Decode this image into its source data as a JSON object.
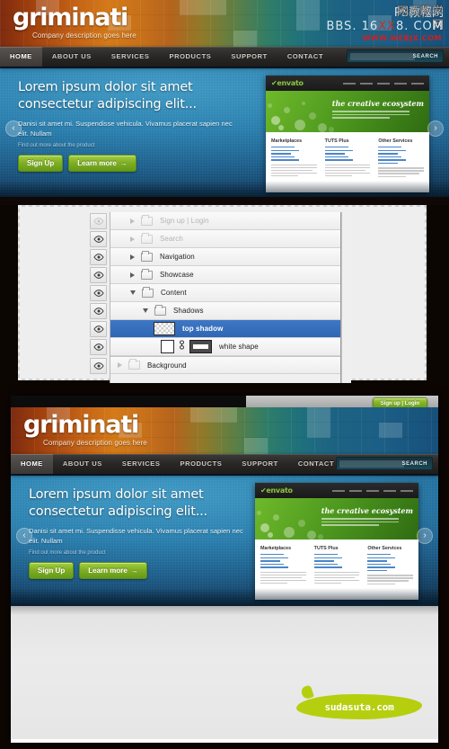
{
  "brand": {
    "logo": "griminati",
    "tagline": "Company description goes here",
    "accent_orange": "#d47a19",
    "accent_blue": "#2a7fae",
    "accent_green": "#7fae24"
  },
  "watermark": {
    "line1": "PS教程网",
    "line1_overlay": "网页教学网",
    "line2_pre": "BBS. 16",
    "line2_red": "XX",
    "line2_post": "8. COM",
    "line2_overlay": "WWW.WEBJX.COM"
  },
  "nav": {
    "items": [
      {
        "label": "HOME",
        "active": true
      },
      {
        "label": "ABOUT US",
        "active": false
      },
      {
        "label": "SERVICES",
        "active": false
      },
      {
        "label": "PRODUCTS",
        "active": false
      },
      {
        "label": "SUPPORT",
        "active": false
      },
      {
        "label": "CONTACT",
        "active": false
      }
    ],
    "search_button": "SEARCH",
    "search_placeholder": ""
  },
  "hero": {
    "title": "Lorem ipsum dolor sit amet consectetur adipiscing elit...",
    "body": "Danisi sit amet mi. Suspendisse vehicula. Vivamus placerat sapien nec elit. Nullam",
    "small": "Find out more about the product",
    "primary_button": "Sign Up",
    "secondary_button": "Learn more",
    "secondary_arrow": "→",
    "prev_arrow": "‹",
    "next_arrow": "›"
  },
  "envato": {
    "logo_mark": "✔",
    "logo": "envato",
    "tagline": "the creative ecosystem",
    "columns": [
      {
        "title": "Marketplaces"
      },
      {
        "title": "TUTS Plus"
      },
      {
        "title": "Other Services"
      }
    ]
  },
  "layers_panel": {
    "rows": [
      {
        "name": "Sign up  |  Login",
        "indent": 1,
        "type": "group",
        "expanded": false,
        "visible": false,
        "selected": false,
        "dim": true
      },
      {
        "name": "Search",
        "indent": 1,
        "type": "group",
        "expanded": false,
        "visible": true,
        "selected": false,
        "dim": true
      },
      {
        "name": "Navigation",
        "indent": 1,
        "type": "group",
        "expanded": false,
        "visible": true,
        "selected": false,
        "dim": false
      },
      {
        "name": "Showcase",
        "indent": 1,
        "type": "group",
        "expanded": false,
        "visible": true,
        "selected": false,
        "dim": false
      },
      {
        "name": "Content",
        "indent": 1,
        "type": "group",
        "expanded": true,
        "visible": true,
        "selected": false,
        "dim": false
      },
      {
        "name": "Shadows",
        "indent": 2,
        "type": "group",
        "expanded": true,
        "visible": true,
        "selected": false,
        "dim": false
      },
      {
        "name": "top shadow",
        "indent": 3,
        "type": "layer-transparent",
        "expanded": false,
        "visible": true,
        "selected": true,
        "dim": false
      },
      {
        "name": "white shape",
        "indent": 3,
        "type": "layer-masked",
        "expanded": false,
        "visible": true,
        "selected": false,
        "dim": false
      },
      {
        "name": "Background",
        "indent": 0,
        "type": "group",
        "expanded": false,
        "visible": true,
        "selected": false,
        "dim": false
      }
    ]
  },
  "site2": {
    "signup_login": "Sign up  |  Login",
    "footer_logo": "sudasuta.com"
  }
}
